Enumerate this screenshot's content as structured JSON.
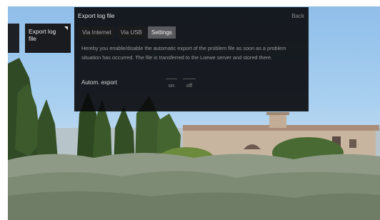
{
  "menu": {
    "small_tile_label": "",
    "export_tile_label": "Export log file"
  },
  "dialog": {
    "title": "Export log file",
    "back_label": "Back",
    "tabs": [
      {
        "label": "Via Internet",
        "active": false
      },
      {
        "label": "Via USB",
        "active": false
      },
      {
        "label": "Settings",
        "active": true
      }
    ],
    "description": "Hereby you enable/disable the automatic export of the problem file as soon as a problem situation has occurred. The file is transferred to the Loewe server and stored there.",
    "setting": {
      "label": "Autom. export",
      "options": [
        "on",
        "off"
      ]
    }
  },
  "colors": {
    "panel_bg": "#0a0a0c",
    "active_tab": "#5a5a5e",
    "text_primary": "#e6e6e6",
    "text_secondary": "#9c9c9c"
  }
}
